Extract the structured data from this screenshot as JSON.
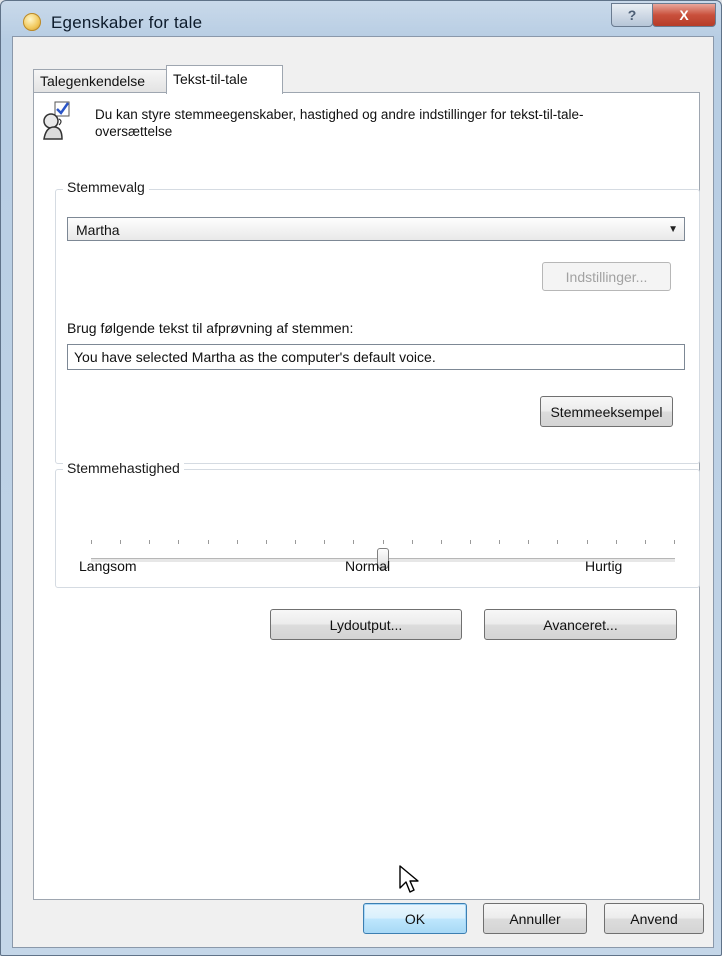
{
  "window": {
    "title": "Egenskaber for tale",
    "help_symbol": "?",
    "close_symbol": "X"
  },
  "tabs": [
    {
      "label": "Talegenkendelse",
      "active": false
    },
    {
      "label": "Tekst-til-tale",
      "active": true
    }
  ],
  "intro": {
    "text": "Du kan styre stemmeegenskaber, hastighed og andre indstillinger for tekst-til-tale-oversættelse",
    "icon": "speech-person-icon"
  },
  "voice_selection": {
    "group_label": "Stemmevalg",
    "selected_voice": "Martha",
    "settings_button": "Indstillinger...",
    "settings_enabled": false,
    "preview_prompt": "Brug følgende tekst til afprøvning af stemmen:",
    "preview_text": "You have selected Martha as the computer's default voice.",
    "preview_button": "Stemmeeksempel"
  },
  "voice_speed": {
    "group_label": "Stemmehastighed",
    "label_slow": "Langsom",
    "label_normal": "Normal",
    "label_fast": "Hurtig",
    "value": 0.5
  },
  "buttons": {
    "audio_output": "Lydoutput...",
    "advanced": "Avanceret...",
    "ok": "OK",
    "cancel": "Annuller",
    "apply": "Anvend"
  },
  "colors": {
    "accent_checkbox": "#2b55c7",
    "close_button": "#c9503c"
  }
}
